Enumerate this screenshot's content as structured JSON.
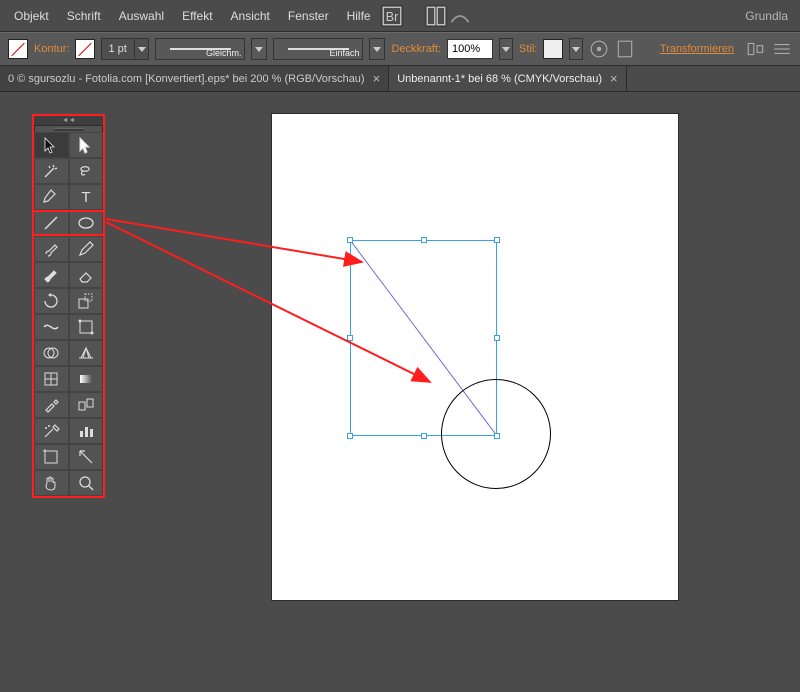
{
  "menu": {
    "items": [
      "Objekt",
      "Schrift",
      "Auswahl",
      "Effekt",
      "Ansicht",
      "Fenster",
      "Hilfe"
    ],
    "right": "Grundla"
  },
  "options": {
    "stroke_label": "Kontur:",
    "stroke_width": "1 pt",
    "profile_uniform": "Gleichm.",
    "brush_basic": "Einfach",
    "opacity_label": "Deckkraft:",
    "opacity_value": "100%",
    "style_label": "Stil:",
    "transform": "Transformieren"
  },
  "tabs": {
    "inactive": "0 © sgursozlu - Fotolia.com [Konvertiert].eps* bei 200 % (RGB/Vorschau)",
    "active": "Unbenannt-1* bei 68 % (CMYK/Vorschau)"
  },
  "tools": {
    "rows": [
      [
        "selection",
        "direct-selection"
      ],
      [
        "magic-wand",
        "lasso"
      ],
      [
        "pen",
        "type"
      ],
      [
        "line-segment",
        "ellipse"
      ],
      [
        "paintbrush",
        "pencil"
      ],
      [
        "blob-brush",
        "eraser"
      ],
      [
        "rotate",
        "scale"
      ],
      [
        "width",
        "free-transform"
      ],
      [
        "shape-builder",
        "perspective-grid"
      ],
      [
        "mesh",
        "gradient"
      ],
      [
        "eyedropper",
        "blend"
      ],
      [
        "symbol-sprayer",
        "column-graph"
      ],
      [
        "artboard",
        "slice"
      ],
      [
        "hand",
        "zoom"
      ]
    ],
    "highlighted_row_index": 3
  }
}
